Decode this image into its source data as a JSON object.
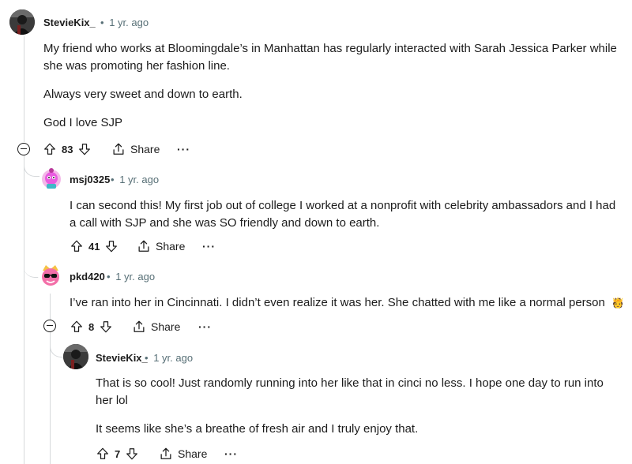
{
  "comments": [
    {
      "author": "StevieKix_",
      "age": "1 yr. ago",
      "paragraphs": [
        "My friend who works at Bloomingdale’s in Manhattan has regularly interacted with Sarah Jessica Parker while she was promoting her fashion line.",
        "Always very sweet and down to earth.",
        "God I love SJP"
      ],
      "votes": "83",
      "share": "Share",
      "more": "···"
    },
    {
      "author": "msj0325",
      "age": "1 yr. ago",
      "paragraphs": [
        "I can second this! My first job out of college I worked at a nonprofit with celebrity ambassadors and I had a call with SJP and she was SO friendly and down to earth."
      ],
      "votes": "41",
      "share": "Share",
      "more": "···"
    },
    {
      "author": "pkd420",
      "age": "1 yr. ago",
      "paragraphs": [
        "I’ve ran into her in Cincinnati. I didn’t even realize it was her. She chatted with me like a normal person"
      ],
      "emoji": "🫅",
      "votes": "8",
      "share": "Share",
      "more": "···"
    },
    {
      "author": "StevieKix_",
      "age": "1 yr. ago",
      "paragraphs": [
        "That is so cool! Just randomly running into her like that in cinci no less. I hope one day to run into her lol",
        "It seems like she’s a breathe of fresh air and I truly enjoy that."
      ],
      "votes": "7",
      "share": "Share",
      "more": "···"
    }
  ],
  "separator": "•",
  "icons": {
    "upvote": "arrow-up-outline-icon",
    "downvote": "arrow-down-outline-icon",
    "share": "share-icon",
    "collapse": "minus-circle-icon",
    "more": "ellipsis-icon"
  },
  "colors": {
    "meta": "#576f76",
    "thread": "#d6d9db",
    "text": "#1c1c1c"
  }
}
